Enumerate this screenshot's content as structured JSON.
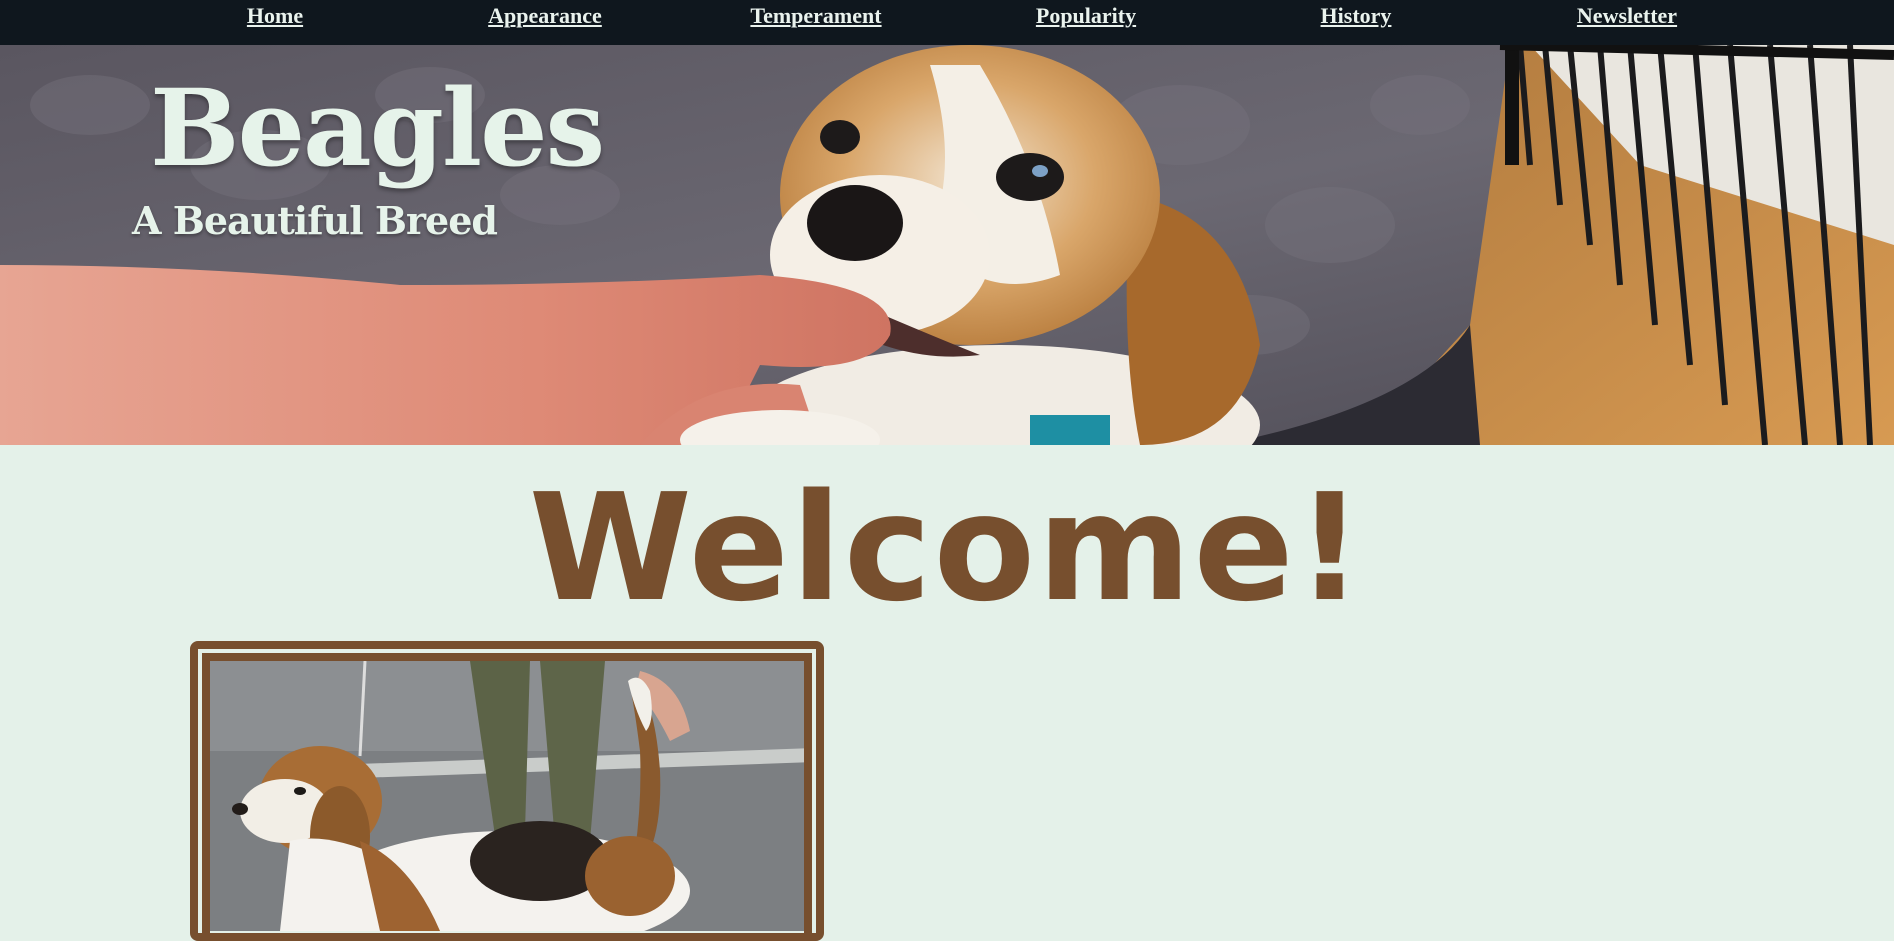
{
  "nav": {
    "items": [
      {
        "label": "Home"
      },
      {
        "label": "Appearance"
      },
      {
        "label": "Temperament"
      },
      {
        "label": "Popularity"
      },
      {
        "label": "History"
      },
      {
        "label": "Newsletter"
      }
    ]
  },
  "hero": {
    "title": "Beagles",
    "subtitle": "A Beautiful Breed",
    "image": "beagle-puppy-biting-finger-photo"
  },
  "main": {
    "heading": "Welcome!",
    "image": "beagle-show-stance-photo"
  },
  "colors": {
    "nav_background": "#0f171e",
    "nav_text": "#eaf3ee",
    "page_background": "#e4f1e9",
    "accent_brown": "#774f2e",
    "hero_text": "#e6f3ea"
  }
}
